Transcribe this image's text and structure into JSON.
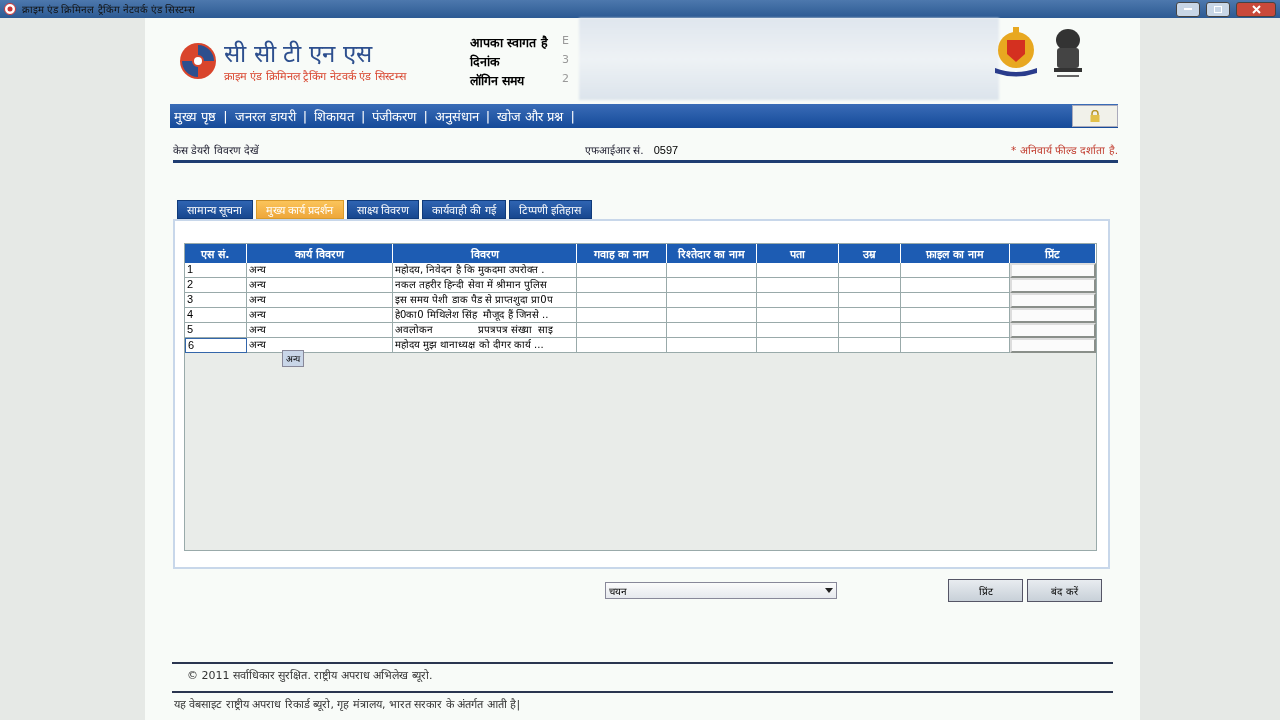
{
  "window": {
    "title": "क्राइम एंड क्रिमिनल ट्रैकिंग नेटवर्क एंड सिस्टम्स"
  },
  "header": {
    "logo_title": "सी सी टी एन एस",
    "logo_subtitle": "क्राइम एंड क्रिमिनल ट्रैकिंग नेटवर्क एंड सिस्टम्स",
    "welcome": [
      {
        "label": "आपका स्वागत है",
        "value": "E"
      },
      {
        "label": "दिनांक",
        "value": "3"
      },
      {
        "label": "लॉगिन समय",
        "value": "2"
      }
    ]
  },
  "nav": {
    "separator": "|",
    "items": [
      "मुख्य पृष्ठ",
      "जनरल डायरी",
      "शिकायत",
      "पंजीकरण",
      "अनुसंधान",
      "खोज और प्रश्न"
    ]
  },
  "subheader": {
    "title": "केस डेयरी विवरण देखें",
    "fir_label": "एफआईआर सं.",
    "fir_number": "0597",
    "mandatory_note": "* अनिवार्य फील्ड दर्शाता है."
  },
  "tabs": [
    {
      "label": "सामान्य सूचना",
      "selected": false
    },
    {
      "label": "मुख्य कार्य प्रदर्शन",
      "selected": true
    },
    {
      "label": "साक्ष्य विवरण",
      "selected": false
    },
    {
      "label": "कार्यवाही की गई",
      "selected": false
    },
    {
      "label": "टिप्पणी इतिहास",
      "selected": false
    }
  ],
  "table": {
    "columns": [
      "एस सं.",
      "कार्य विवरण",
      "विवरण",
      "गवाह का नाम",
      "रिश्तेदार का नाम",
      "पता",
      "उम्र",
      "फ़ाइल का नाम",
      "प्रिंट"
    ],
    "rows": [
      {
        "sl": "1",
        "work": "अन्य",
        "details": "महोदय, निवेदन है कि मुकदमा उपरोक्त .",
        "selected": false
      },
      {
        "sl": "2",
        "work": "अन्य",
        "details": "नकल तहरीर हिन्दी सेवा में श्रीमान पुलिस",
        "selected": false
      },
      {
        "sl": "3",
        "work": "अन्य",
        "details": "इस समय पेशी डाक पैड से प्राप्तशुदा प्रा0प",
        "selected": false
      },
      {
        "sl": "4",
        "work": "अन्य",
        "details": "हे0का0 मिथिलेश सिंह  मौजूद हैं जिनसे ..",
        "selected": false
      },
      {
        "sl": "5",
        "work": "अन्य",
        "details": "अवलोकन              प्रपत्रपत्र संख्या  साइ",
        "selected": false
      },
      {
        "sl": "6",
        "work": "अन्य",
        "details": "महोदय मुझ थानाध्यक्ष को दीगर कार्य ...",
        "selected": true
      }
    ],
    "tooltip": "अन्य"
  },
  "actions": {
    "dropdown": {
      "value": "चयन"
    },
    "buttons": [
      "प्रिंट",
      "बंद करें"
    ]
  },
  "footer": {
    "copyright": "© 2011 सर्वाधिकार सुरक्षित. राष्ट्रीय अपराध अभिलेख ब्यूरो.",
    "note": "यह वेबसाइट राष्ट्रीय अपराध रिकार्ड ब्यूरो, गृह मंत्रालय, भारत सरकार के अंतर्गत आती है|"
  }
}
